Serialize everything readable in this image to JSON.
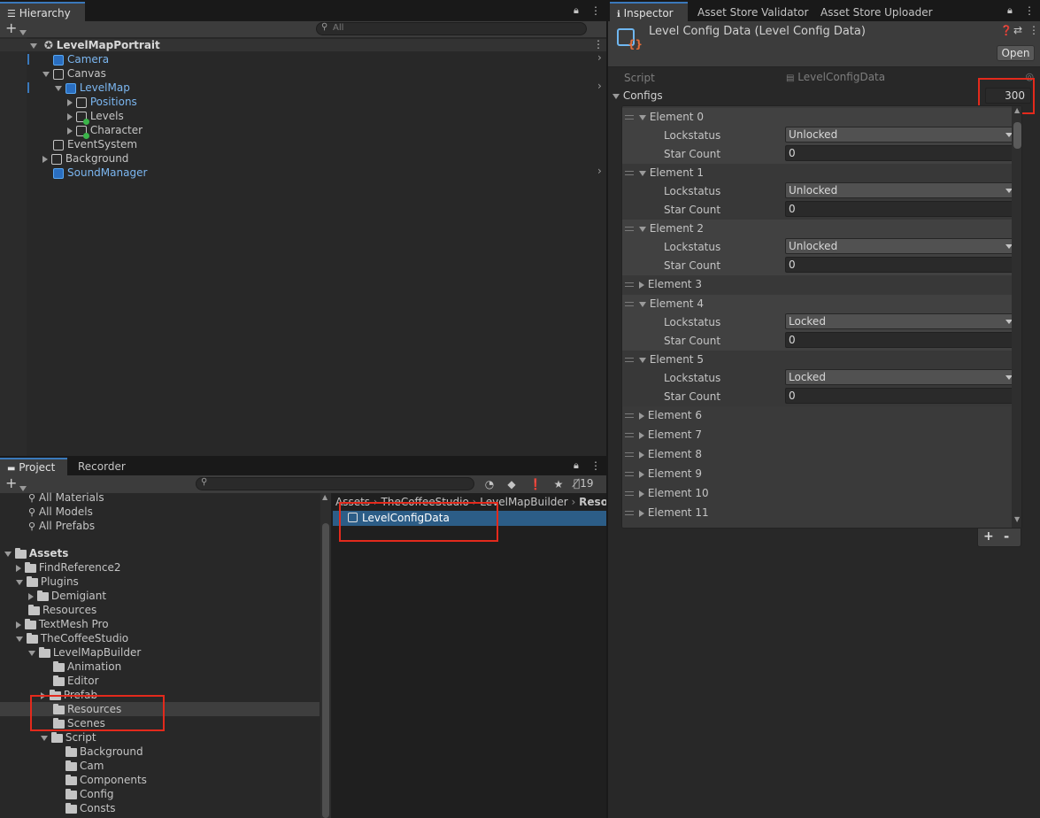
{
  "hierarchy": {
    "tab": "Hierarchy",
    "search_placeholder": "All",
    "scene": "LevelMapPortrait",
    "items": [
      {
        "label": "Camera"
      },
      {
        "label": "Canvas"
      },
      {
        "label": "LevelMap"
      },
      {
        "label": "Positions"
      },
      {
        "label": "Levels"
      },
      {
        "label": "Character"
      },
      {
        "label": "EventSystem"
      },
      {
        "label": "Background"
      },
      {
        "label": "SoundManager"
      }
    ]
  },
  "project": {
    "tabs": [
      "Project",
      "Recorder"
    ],
    "hidden_count": "19",
    "favorites": [
      "All Materials",
      "All Models",
      "All Prefabs"
    ],
    "tree": [
      "Assets",
      "FindReference2",
      "Plugins",
      "Demigiant",
      "Resources",
      "TextMesh Pro",
      "TheCoffeeStudio",
      "LevelMapBuilder",
      "Animation",
      "Editor",
      "Prefab",
      "Resources",
      "Scenes",
      "Script",
      "Background",
      "Cam",
      "Components",
      "Config",
      "Consts"
    ],
    "breadcrumb": [
      "Assets",
      "TheCoffeeStudio",
      "LevelMapBuilder",
      "Reso"
    ],
    "selected_asset": "LevelConfigData"
  },
  "inspector": {
    "tabs": [
      "Inspector",
      "Asset Store Validator",
      "Asset Store Uploader"
    ],
    "title": "Level Config Data (Level Config Data)",
    "open_label": "Open",
    "script_label": "Script",
    "script_value": "LevelConfigData",
    "configs_label": "Configs",
    "configs_count": "300",
    "lockstatus_label": "Lockstatus",
    "star_count_label": "Star Count",
    "elements": [
      {
        "name": "Element 0",
        "expanded": true,
        "lockstatus": "Unlocked",
        "star_count": "0"
      },
      {
        "name": "Element 1",
        "expanded": true,
        "lockstatus": "Unlocked",
        "star_count": "0"
      },
      {
        "name": "Element 2",
        "expanded": true,
        "lockstatus": "Unlocked",
        "star_count": "0"
      },
      {
        "name": "Element 3",
        "expanded": false
      },
      {
        "name": "Element 4",
        "expanded": true,
        "lockstatus": "Locked",
        "star_count": "0"
      },
      {
        "name": "Element 5",
        "expanded": true,
        "lockstatus": "Locked",
        "star_count": "0"
      },
      {
        "name": "Element 6",
        "expanded": false
      },
      {
        "name": "Element 7",
        "expanded": false
      },
      {
        "name": "Element 8",
        "expanded": false
      },
      {
        "name": "Element 9",
        "expanded": false
      },
      {
        "name": "Element 10",
        "expanded": false
      },
      {
        "name": "Element 11",
        "expanded": false
      }
    ],
    "add_label": "+",
    "remove_label": "-"
  },
  "colors": {
    "highlight": "#e32a1c",
    "selection": "#2c5d87",
    "link_blue": "#7bb6f0"
  }
}
